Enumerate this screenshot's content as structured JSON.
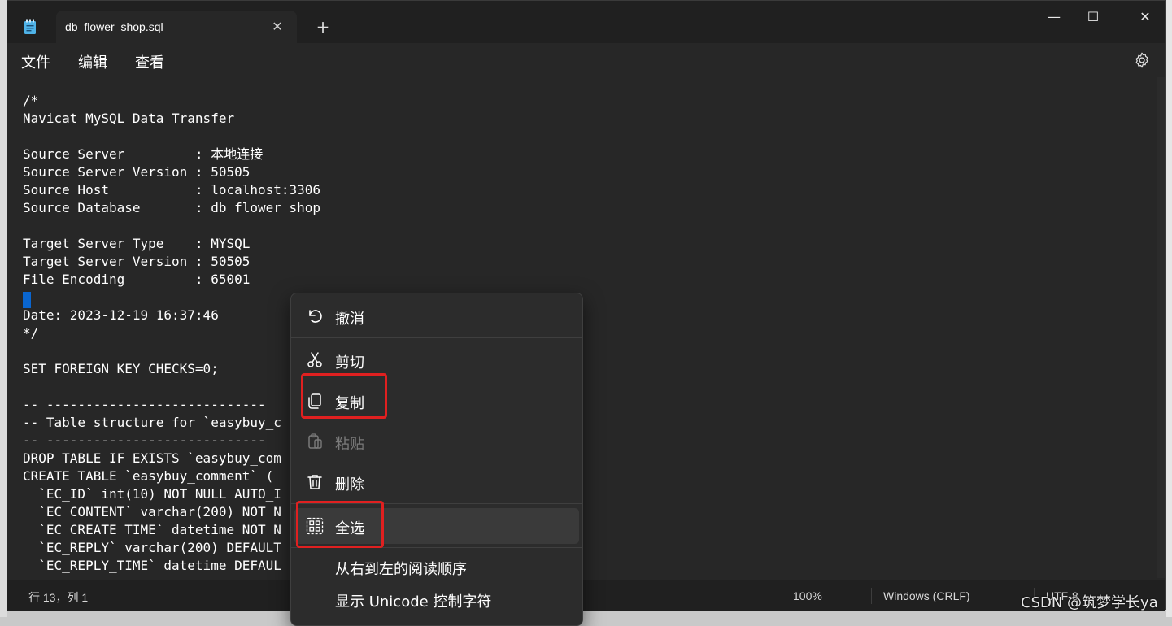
{
  "window": {
    "tab_title": "db_flower_shop.sql",
    "close_glyph": "✕",
    "new_tab_glyph": "+",
    "min_glyph": "—",
    "max_glyph": "☐",
    "win_close_glyph": "✕"
  },
  "menubar": {
    "file": "文件",
    "edit": "编辑",
    "view": "查看"
  },
  "editor": {
    "lines": [
      "/*",
      "Navicat MySQL Data Transfer",
      "",
      "Source Server         : 本地连接",
      "Source Server Version : 50505",
      "Source Host           : localhost:3306",
      "Source Database       : db_flower_shop",
      "",
      "Target Server Type    : MYSQL",
      "Target Server Version : 50505",
      "File Encoding         : 65001",
      "",
      "Date: 2023-12-19 16:37:46",
      "*/",
      "",
      "SET FOREIGN_KEY_CHECKS=0;",
      "",
      "-- ----------------------------",
      "-- Table structure for `easybuy_c",
      "-- ----------------------------",
      "DROP TABLE IF EXISTS `easybuy_com",
      "CREATE TABLE `easybuy_comment` (",
      "  `EC_ID` int(10) NOT NULL AUTO_I",
      "  `EC_CONTENT` varchar(200) NOT N",
      "  `EC_CREATE_TIME` datetime NOT N",
      "  `EC_REPLY` varchar(200) DEFAULT",
      "  `EC_REPLY_TIME` datetime DEFAUL"
    ]
  },
  "statusbar": {
    "position": "行 13，列 1",
    "zoom": "100%",
    "line_ending": "Windows (CRLF)",
    "encoding": "UTF-8"
  },
  "context_menu": {
    "undo": "撤消",
    "cut": "剪切",
    "copy": "复制",
    "paste": "粘贴",
    "delete": "删除",
    "select_all": "全选",
    "rtl": "从右到左的阅读顺序",
    "unicode": "显示 Unicode 控制字符"
  },
  "watermark": "CSDN @筑梦学长ya",
  "colors": {
    "highlight": "#e02020",
    "caret": "#0a66d0"
  }
}
